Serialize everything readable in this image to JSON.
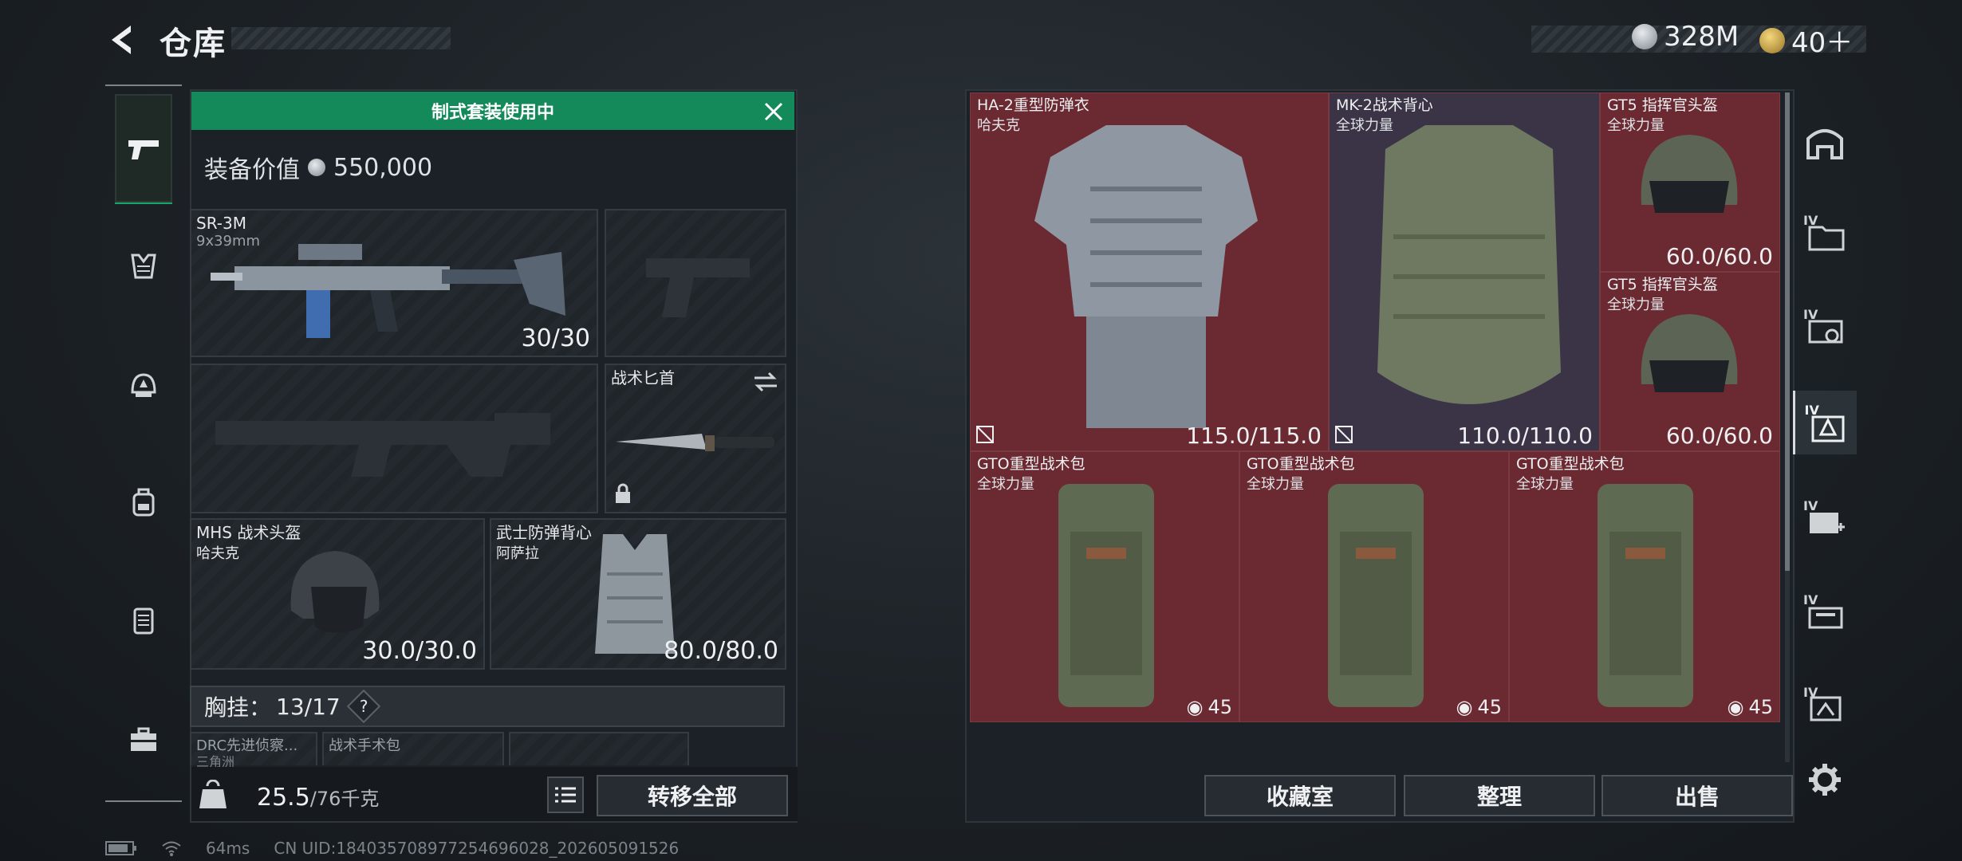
{
  "header": {
    "title": "仓库",
    "silver_amount": "328M",
    "gold_amount": "40＋"
  },
  "loadout": {
    "banner": "制式套装使用中",
    "value_label": "装备价值",
    "value": "550,000",
    "primary": {
      "name": "SR-3M",
      "ammo": "9x39mm",
      "durability": "30/30"
    },
    "knife": {
      "name": "战术匕首"
    },
    "helmet": {
      "name": "MHS 战术头盔",
      "brand": "哈夫克",
      "durability": "30.0/30.0"
    },
    "armor": {
      "name": "武士防弹背心",
      "brand": "阿萨拉",
      "durability": "80.0/80.0"
    },
    "chest_label": "胸挂：",
    "chest_value": "13/17",
    "chest_help": "?",
    "peek_items": [
      "DRC先进侦察...",
      "三角洲",
      "战术手术包"
    ],
    "weight_value": "25.5",
    "weight_max": "/76千克",
    "transfer_all": "转移全部"
  },
  "storage": {
    "items": [
      {
        "name": "HA-2重型防弹衣",
        "brand": "哈夫克",
        "durability": "115.0/115.0"
      },
      {
        "name": "MK-2战术背心",
        "brand": "全球力量",
        "durability": "110.0/110.0"
      },
      {
        "name": "GT5 指挥官头盔",
        "brand": "全球力量",
        "durability": "60.0/60.0"
      },
      {
        "name": "GT5 指挥官头盔",
        "brand": "全球力量",
        "durability": "60.0/60.0"
      },
      {
        "name": "GTO重型战术包",
        "brand": "全球力量",
        "capacity": "45"
      },
      {
        "name": "GTO重型战术包",
        "brand": "全球力量",
        "capacity": "45"
      },
      {
        "name": "GTO重型战术包",
        "brand": "全球力量",
        "capacity": "45"
      }
    ],
    "btn_collection": "收藏室",
    "btn_sort": "整理",
    "btn_sell": "出售",
    "tier_label": "IV"
  },
  "status": {
    "ping": "64ms",
    "uid": "CN UID:1840357089772546960​28_202605091526"
  },
  "colors": {
    "accent": "#148a5b",
    "cell_red": "#6b2a32"
  }
}
